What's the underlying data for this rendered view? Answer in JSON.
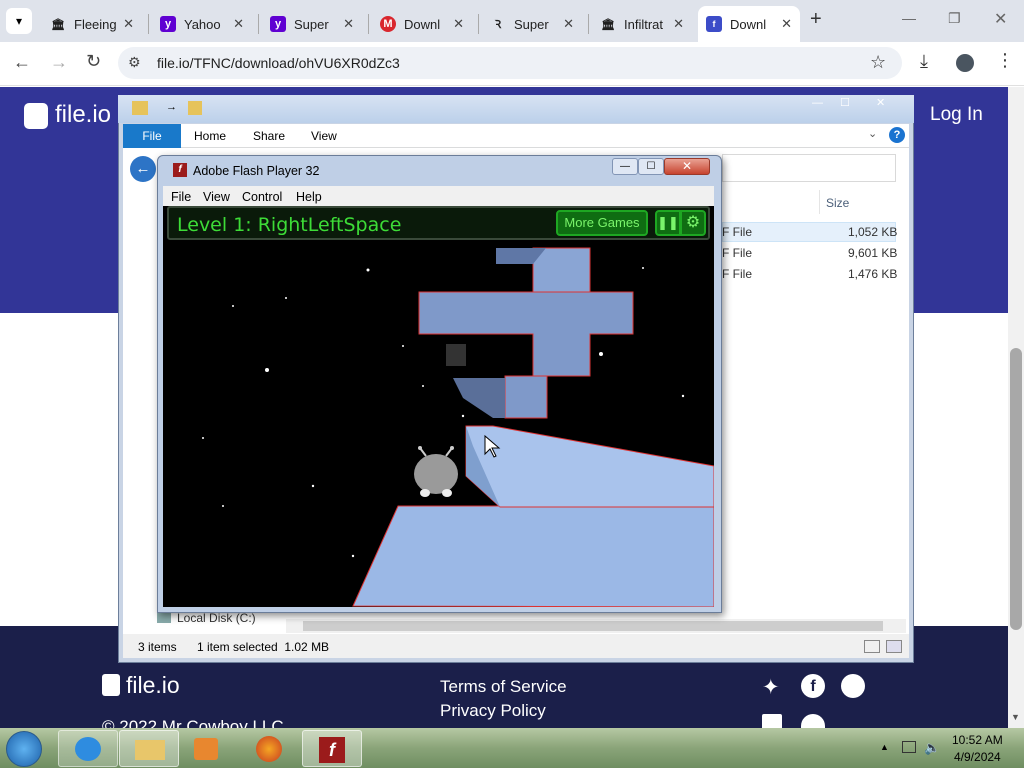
{
  "browser": {
    "tabs": [
      {
        "label": "Fleeing",
        "icon": "museum-icon"
      },
      {
        "label": "Yahoo",
        "icon": "yahoo-icon"
      },
      {
        "label": "Super",
        "icon": "yahoo-icon"
      },
      {
        "label": "Downl",
        "icon": "mega-icon"
      },
      {
        "label": "Super",
        "icon": "link-icon"
      },
      {
        "label": "Infiltrat",
        "icon": "museum-icon"
      },
      {
        "label": "Downl",
        "icon": "fileio-icon"
      }
    ],
    "new_tab": "+",
    "url": "file.io/TFNC/download/ohVU6XR0dZc3"
  },
  "fileio": {
    "logo": "file.io",
    "login": "Log In",
    "footer_logo": "file.io",
    "terms": "Terms of Service",
    "privacy": "Privacy Policy",
    "copyright": "© 2022 Mr Cowboy LLC"
  },
  "explorer": {
    "ribbon_tabs": [
      "File",
      "Home",
      "Share",
      "View"
    ],
    "col_size": "Size",
    "rows": [
      {
        "type": "F File",
        "size": "1,052 KB"
      },
      {
        "type": "F File",
        "size": "9,601 KB"
      },
      {
        "type": "F File",
        "size": "1,476 KB"
      }
    ],
    "nav_item": "Local Disk (C:)",
    "status_items": "3 items",
    "status_selected": "1 item selected  1.02 MB"
  },
  "flash": {
    "title": "Adobe Flash Player 32",
    "menu": [
      "File",
      "View",
      "Control",
      "Help"
    ],
    "level_text": "Level 1: RightLeftSpace",
    "more_games": "More Games"
  },
  "taskbar": {
    "time": "10:52 AM",
    "date": "4/9/2024"
  },
  "colors": {
    "fileio_blue": "#323597",
    "fileio_footer": "#1b1f4a",
    "game_green": "#3ddc37",
    "tunnel_blue": "#9bb8e6"
  }
}
